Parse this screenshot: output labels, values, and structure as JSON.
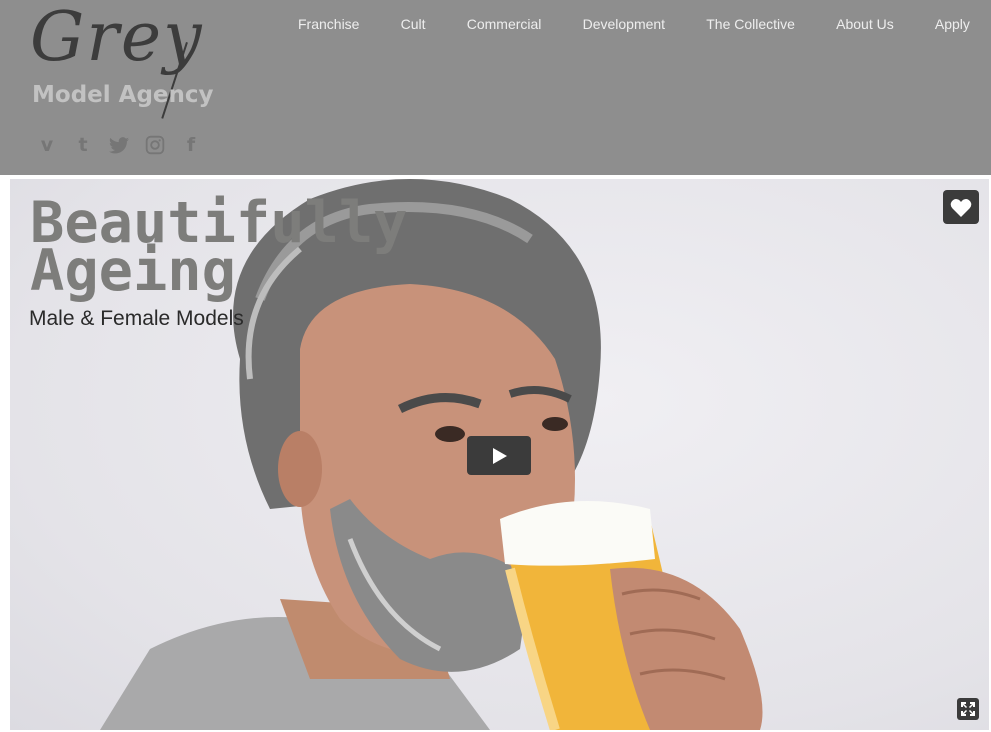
{
  "header": {
    "logo_script": "Grey",
    "logo_sub": "Model Agency",
    "social": [
      {
        "name": "vimeo-icon",
        "glyph": "v"
      },
      {
        "name": "tumblr-icon",
        "glyph": "t"
      },
      {
        "name": "twitter-icon",
        "glyph": ""
      },
      {
        "name": "instagram-icon",
        "glyph": ""
      },
      {
        "name": "facebook-icon",
        "glyph": "f"
      }
    ],
    "nav": [
      {
        "name": "nav-franchise",
        "label": "Franchise"
      },
      {
        "name": "nav-cult",
        "label": "Cult"
      },
      {
        "name": "nav-commercial",
        "label": "Commercial"
      },
      {
        "name": "nav-development",
        "label": "Development"
      },
      {
        "name": "nav-the-collective",
        "label": "The Collective"
      },
      {
        "name": "nav-about-us",
        "label": "About Us"
      },
      {
        "name": "nav-apply",
        "label": "Apply"
      }
    ]
  },
  "hero": {
    "title_line1": "Beautifully",
    "title_line2": "Ageing",
    "subtitle": "Male & Female Models",
    "controls": {
      "play": "play-icon",
      "like": "heart-icon",
      "fullscreen": "expand-icon"
    }
  },
  "colors": {
    "header_bg": "#8e8e8e",
    "nav_text": "#eeeeee",
    "logo_dark": "#3c3c3c",
    "logo_light": "#c2c2c2",
    "title_text": "#7d7d7b",
    "control_bg": "#3b3b3b"
  }
}
